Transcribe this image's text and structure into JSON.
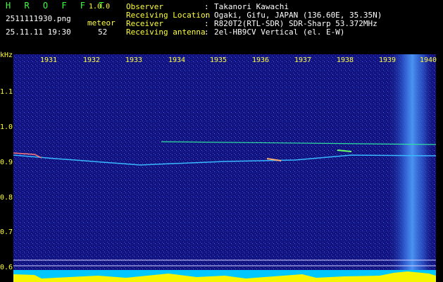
{
  "app": {
    "title": "H R O F F T",
    "version": "1.0.0"
  },
  "file": {
    "name": "2511111930.png",
    "datetime": "25.11.11 19:30"
  },
  "meteor": {
    "label": "meteor",
    "count": "52"
  },
  "info": [
    {
      "label": "Observer",
      "value": "Takanori Kawachi"
    },
    {
      "label": "Receiving Location",
      "value": "Ogaki, Gifu, JAPAN (136.60E, 35.35N)"
    },
    {
      "label": "Receiver",
      "value": "R820T2(RTL-SDR) SDR-Sharp 53.372MHz"
    },
    {
      "label": "Receiving antenna",
      "value": "2el-HB9CV Vertical (el. E-W)"
    }
  ],
  "y_axis": {
    "unit": "kHz",
    "ticks": [
      "1.1",
      "1.0",
      "0.9",
      "0.8",
      "0.7",
      "0.6"
    ]
  },
  "x_axis": {
    "ticks": [
      "1931",
      "1932",
      "1933",
      "1934",
      "1935",
      "1936",
      "1937",
      "1938",
      "1939",
      "1940"
    ]
  },
  "colors": {
    "label": "#ffffff",
    "title": "#3cff3c",
    "axis": "#ffff3c",
    "background": "#12127e",
    "baseline": "#00c8ff"
  }
}
